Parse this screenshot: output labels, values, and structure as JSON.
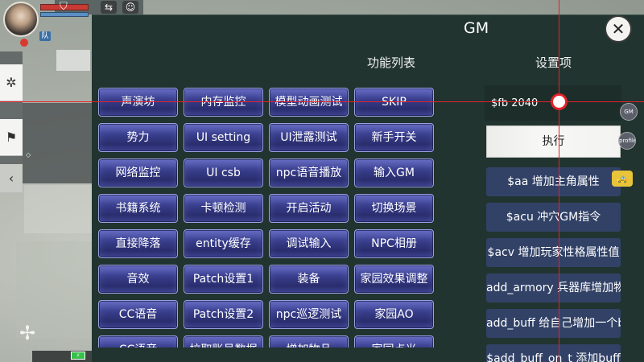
{
  "gm_panel": {
    "title": "GM",
    "close_icon": "close-x-icon",
    "function_list_header": "功能列表",
    "settings_header": "设置项"
  },
  "function_buttons": [
    "声演坊",
    "内存监控",
    "模型动画测试",
    "SKIP",
    "势力",
    "UI setting",
    "UI泄露测试",
    "新手开关",
    "网络监控",
    "UI csb",
    "npc语音播放",
    "输入GM",
    "书籍系统",
    "卡顿检测",
    "开启活动",
    "切换场景",
    "直接降落",
    "entity缓存",
    "调试输入",
    "NPC相册",
    "音效",
    "Patch设置1",
    "装备",
    "家园效果调整",
    "CC语音",
    "Patch设置2",
    "npc巡逻测试",
    "家园AO",
    "CC语音",
    "拉取账号数据",
    "增加物品",
    "家园点光"
  ],
  "settings": {
    "command_input_value": "$fb 2040",
    "execute_label": "执行",
    "commands": [
      "$aa 增加主角属性",
      "$acu 冲穴GM指令",
      "$acv 增加玩家性格属性值",
      "add_armory 兵器库增加物品",
      "add_buff 给自己增加一个buff",
      "$add_buff_on_t 添加buff"
    ]
  },
  "hud": {
    "team_badge": "队",
    "orb_gm": "GM",
    "orb_profile": "profile",
    "battery": "⚡"
  },
  "icons": {
    "shield": "shield-icon",
    "pinwheel": "pinwheel-icon",
    "fan": "fan-icon",
    "flag": "flag-icon",
    "collapse": "chevron-left-icon"
  },
  "colors": {
    "panel_bg": "#213430",
    "func_button": "#3a3f8f",
    "command_button": "#324267",
    "crosshair": "#e2222a"
  }
}
